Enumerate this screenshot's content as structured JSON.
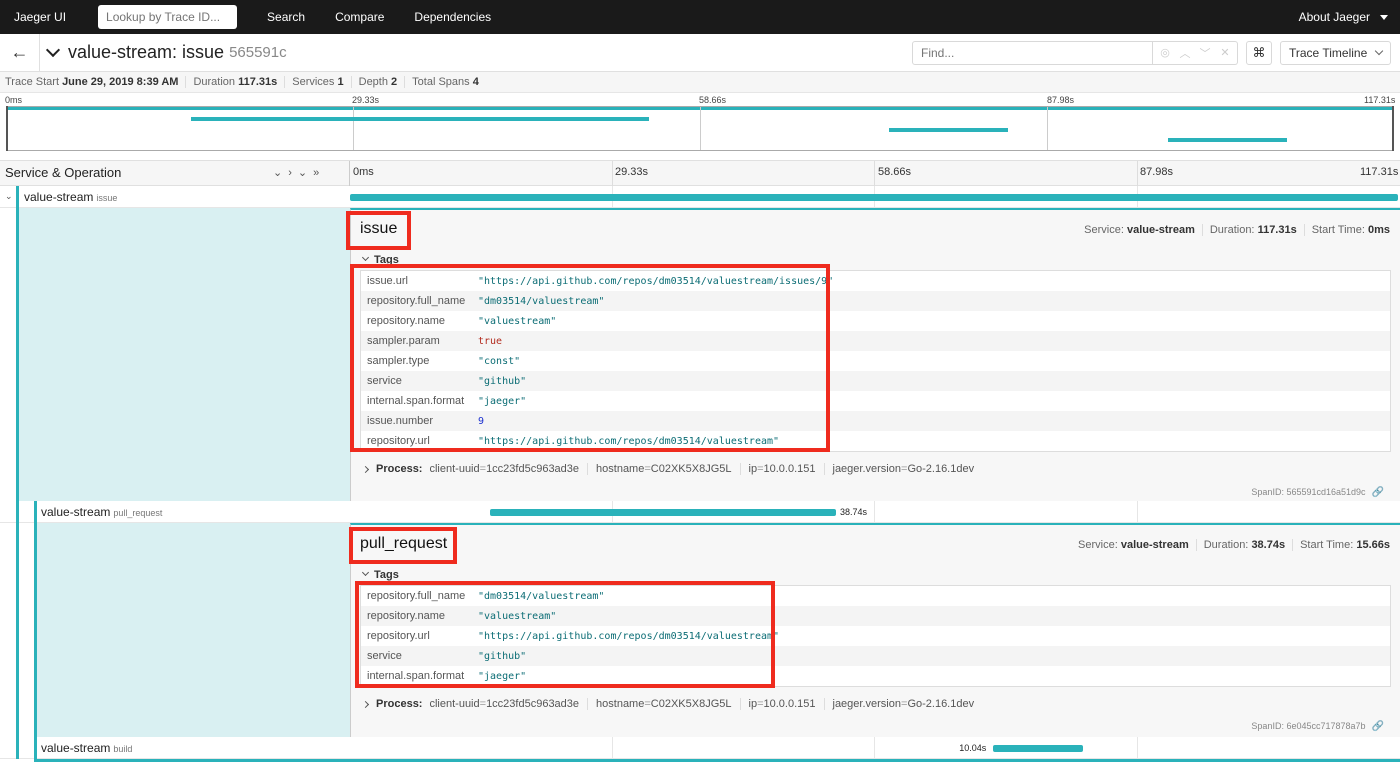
{
  "nav": {
    "brand": "Jaeger UI",
    "lookup_placeholder": "Lookup by Trace ID...",
    "links": [
      "Search",
      "Compare",
      "Dependencies"
    ],
    "about": "About Jaeger"
  },
  "trace": {
    "title": "value-stream: issue",
    "id": "565591c",
    "find_placeholder": "Find...",
    "view_mode": "Trace Timeline",
    "kbd_glyph": "⌘"
  },
  "summary": {
    "trace_start_label": "Trace Start",
    "trace_start": "June 29, 2019 8:39 AM",
    "duration_label": "Duration",
    "duration": "117.31s",
    "services_label": "Services",
    "services": "1",
    "depth_label": "Depth",
    "depth": "2",
    "total_spans_label": "Total Spans",
    "total_spans": "4"
  },
  "ticks": [
    "0ms",
    "29.33s",
    "58.66s",
    "87.98s",
    "117.31s"
  ],
  "timeline": {
    "header_label": "Service & Operation",
    "total_duration_s": 117.31
  },
  "spans": [
    {
      "service": "value-stream",
      "operation": "issue",
      "start_s": 0,
      "duration_s": 117.31,
      "duration_label": ""
    },
    {
      "service": "value-stream",
      "operation": "pull_request",
      "start_s": 15.66,
      "duration_s": 38.74,
      "duration_label": "38.74s"
    },
    {
      "service": "value-stream",
      "operation": "build",
      "start_s": 72.0,
      "duration_s": 10.04,
      "duration_label": "10.04s"
    }
  ],
  "details": [
    {
      "title": "issue",
      "service_label": "Service:",
      "service": "value-stream",
      "duration_label": "Duration:",
      "duration": "117.31s",
      "start_label": "Start Time:",
      "start": "0ms",
      "tags_label": "Tags",
      "tags": [
        {
          "key": "issue.url",
          "value": "\"https://api.github.com/repos/dm03514/valuestream/issues/9\"",
          "type": "str"
        },
        {
          "key": "repository.full_name",
          "value": "\"dm03514/valuestream\"",
          "type": "str"
        },
        {
          "key": "repository.name",
          "value": "\"valuestream\"",
          "type": "str"
        },
        {
          "key": "sampler.param",
          "value": "true",
          "type": "bool"
        },
        {
          "key": "sampler.type",
          "value": "\"const\"",
          "type": "str"
        },
        {
          "key": "service",
          "value": "\"github\"",
          "type": "str"
        },
        {
          "key": "internal.span.format",
          "value": "\"jaeger\"",
          "type": "str"
        },
        {
          "key": "issue.number",
          "value": "9",
          "type": "num"
        },
        {
          "key": "repository.url",
          "value": "\"https://api.github.com/repos/dm03514/valuestream\"",
          "type": "str"
        }
      ],
      "process_label": "Process:",
      "process": [
        {
          "key": "client-uuid",
          "value": "1cc23fd5c963ad3e"
        },
        {
          "key": "hostname",
          "value": "C02XK5X8JG5L"
        },
        {
          "key": "ip",
          "value": "10.0.0.151"
        },
        {
          "key": "jaeger.version",
          "value": "Go-2.16.1dev"
        }
      ],
      "spanid_label": "SpanID:",
      "spanid": "565591cd16a51d9c"
    },
    {
      "title": "pull_request",
      "service_label": "Service:",
      "service": "value-stream",
      "duration_label": "Duration:",
      "duration": "38.74s",
      "start_label": "Start Time:",
      "start": "15.66s",
      "tags_label": "Tags",
      "tags": [
        {
          "key": "repository.full_name",
          "value": "\"dm03514/valuestream\"",
          "type": "str"
        },
        {
          "key": "repository.name",
          "value": "\"valuestream\"",
          "type": "str"
        },
        {
          "key": "repository.url",
          "value": "\"https://api.github.com/repos/dm03514/valuestream\"",
          "type": "str"
        },
        {
          "key": "service",
          "value": "\"github\"",
          "type": "str"
        },
        {
          "key": "internal.span.format",
          "value": "\"jaeger\"",
          "type": "str"
        }
      ],
      "process_label": "Process:",
      "process": [
        {
          "key": "client-uuid",
          "value": "1cc23fd5c963ad3e"
        },
        {
          "key": "hostname",
          "value": "C02XK5X8JG5L"
        },
        {
          "key": "ip",
          "value": "10.0.0.151"
        },
        {
          "key": "jaeger.version",
          "value": "Go-2.16.1dev"
        }
      ],
      "spanid_label": "SpanID:",
      "spanid": "6e045cc717878a7b"
    }
  ],
  "colors": {
    "span_bar": "#2ab2ba",
    "highlight": "#ef2b1e",
    "detail_tint": "#d9f0f2"
  }
}
